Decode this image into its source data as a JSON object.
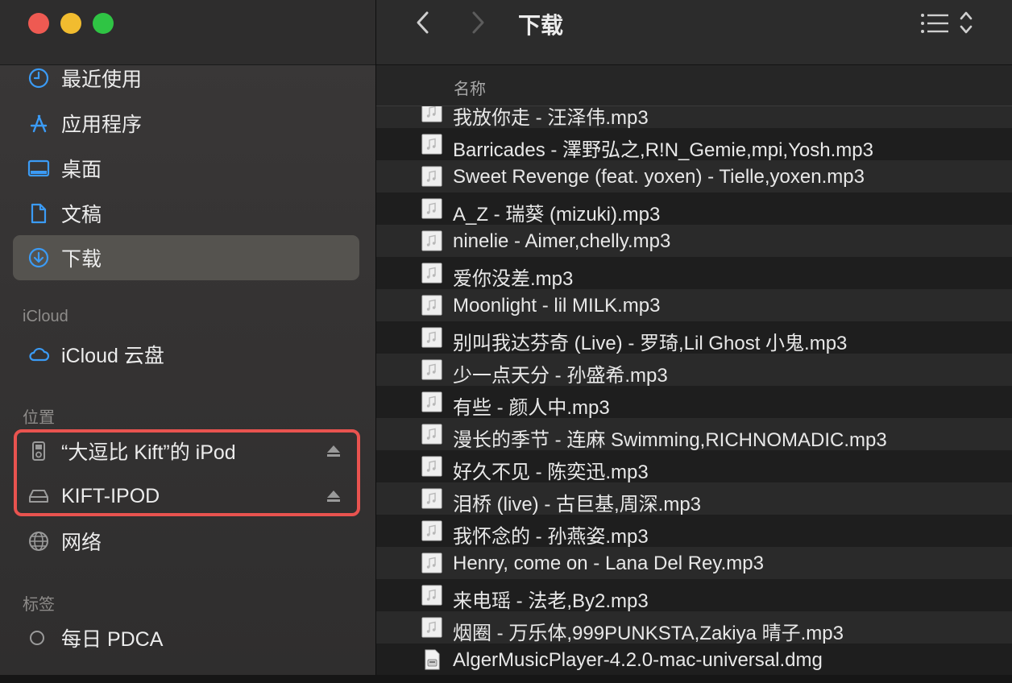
{
  "window": {
    "title": "下载"
  },
  "sidebar": {
    "favorites": [
      {
        "label": "最近使用",
        "icon": "clock-icon"
      },
      {
        "label": "应用程序",
        "icon": "apps-icon"
      },
      {
        "label": "桌面",
        "icon": "desktop-icon"
      },
      {
        "label": "文稿",
        "icon": "document-icon"
      },
      {
        "label": "下载",
        "icon": "download-icon",
        "selected": true
      }
    ],
    "icloud_heading": "iCloud",
    "icloud_items": [
      {
        "label": "iCloud 云盘",
        "icon": "cloud-icon"
      }
    ],
    "locations_heading": "位置",
    "locations": [
      {
        "label": "“大逗比 Kift”的 iPod",
        "icon": "ipod-icon",
        "ejectable": true
      },
      {
        "label": "KIFT-IPOD",
        "icon": "drive-icon",
        "ejectable": true
      },
      {
        "label": "网络",
        "icon": "network-icon",
        "ejectable": false
      }
    ],
    "tags_heading": "标签",
    "tags": [
      {
        "label": "每日 PDCA",
        "icon": "tag-circle-icon"
      }
    ]
  },
  "list": {
    "column_name": "名称",
    "files": [
      {
        "name": "我放你走 - 汪泽伟.mp3",
        "type": "audio"
      },
      {
        "name": "Barricades - 澤野弘之,R!N_Gemie,mpi,Yosh.mp3",
        "type": "audio"
      },
      {
        "name": "Sweet Revenge (feat. yoxen) - Tielle,yoxen.mp3",
        "type": "audio"
      },
      {
        "name": "A_Z - 瑞葵 (mizuki).mp3",
        "type": "audio"
      },
      {
        "name": "ninelie - Aimer,chelly.mp3",
        "type": "audio"
      },
      {
        "name": "爱你没差.mp3",
        "type": "audio"
      },
      {
        "name": "Moonlight - lil MILK.mp3",
        "type": "audio"
      },
      {
        "name": "别叫我达芬奇 (Live) - 罗琦,Lil Ghost 小鬼.mp3",
        "type": "audio"
      },
      {
        "name": "少一点天分 - 孙盛希.mp3",
        "type": "audio"
      },
      {
        "name": "有些 - 颜人中.mp3",
        "type": "audio"
      },
      {
        "name": "漫长的季节 - 连麻 Swimming,RICHNOMADIC.mp3",
        "type": "audio"
      },
      {
        "name": "好久不见 - 陈奕迅.mp3",
        "type": "audio"
      },
      {
        "name": "泪桥 (live) - 古巨基,周深.mp3",
        "type": "audio"
      },
      {
        "name": "我怀念的 - 孙燕姿.mp3",
        "type": "audio"
      },
      {
        "name": "Henry, come on - Lana Del Rey.mp3",
        "type": "audio"
      },
      {
        "name": "来电瑶 - 法老,By2.mp3",
        "type": "audio"
      },
      {
        "name": "烟圈 - 万乐体,999PUNKSTA,Zakiya 晴子.mp3",
        "type": "audio"
      },
      {
        "name": "AlgerMusicPlayer-4.2.0-mac-universal.dmg",
        "type": "dmg"
      }
    ]
  },
  "colors": {
    "selected_bg": "#55534f",
    "accent_blue": "#3b9bf5",
    "highlight_red": "#e9534f"
  }
}
